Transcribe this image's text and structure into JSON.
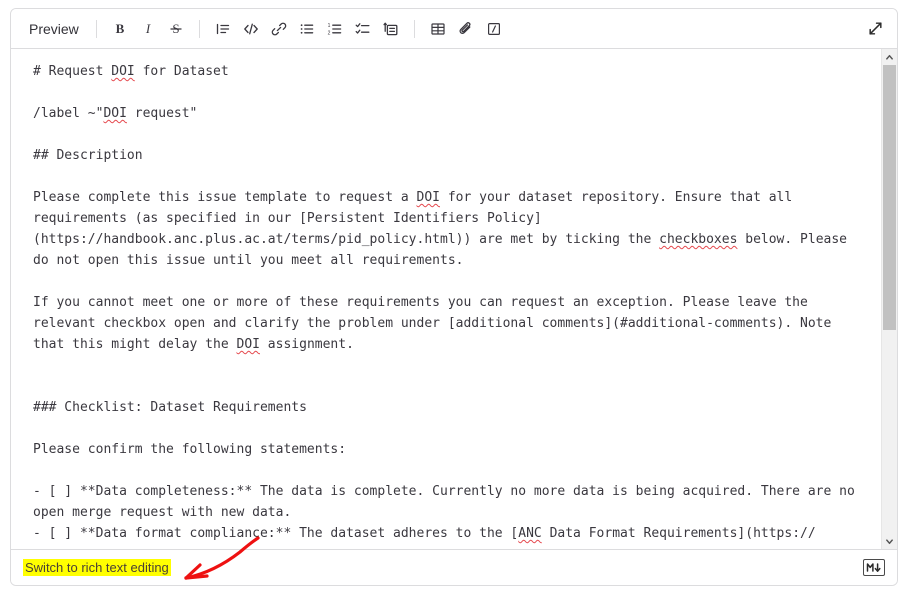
{
  "toolbar": {
    "preview_label": "Preview",
    "buttons": [
      {
        "name": "bold-button",
        "icon": "bold-icon",
        "title": "Bold"
      },
      {
        "name": "italic-button",
        "icon": "italic-icon",
        "title": "Italic"
      },
      {
        "name": "strikethrough-button",
        "icon": "strikethrough-icon",
        "title": "Strikethrough"
      },
      {
        "name": "blockquote-button",
        "icon": "blockquote-icon",
        "title": "Insert a quote"
      },
      {
        "name": "code-button",
        "icon": "code-icon",
        "title": "Insert code"
      },
      {
        "name": "link-button",
        "icon": "link-icon",
        "title": "Insert a link"
      },
      {
        "name": "bullet-list-button",
        "icon": "bullet-list-icon",
        "title": "Add a bullet list"
      },
      {
        "name": "numbered-list-button",
        "icon": "numbered-list-icon",
        "title": "Add a numbered list"
      },
      {
        "name": "checklist-button",
        "icon": "checklist-icon",
        "title": "Add a checklist"
      },
      {
        "name": "collapsible-section-button",
        "icon": "collapsible-section-icon",
        "title": "Add a collapsible section"
      },
      {
        "name": "table-button",
        "icon": "table-icon",
        "title": "Add a table"
      },
      {
        "name": "attach-file-button",
        "icon": "paperclip-icon",
        "title": "Attach a file or image"
      },
      {
        "name": "quick-actions-button",
        "icon": "slash-command-icon",
        "title": "Quick actions"
      }
    ],
    "expand_icon": "expand-diagonal-icon"
  },
  "editor": {
    "lines": [
      {
        "segments": [
          {
            "t": "# Request "
          },
          {
            "t": "DOI",
            "spell": true
          },
          {
            "t": " for Dataset"
          }
        ]
      },
      {
        "segments": [
          {
            "t": ""
          }
        ]
      },
      {
        "segments": [
          {
            "t": "/label ~\""
          },
          {
            "t": "DOI",
            "spell": true
          },
          {
            "t": " request\""
          }
        ]
      },
      {
        "segments": [
          {
            "t": ""
          }
        ]
      },
      {
        "segments": [
          {
            "t": "## Description"
          }
        ]
      },
      {
        "segments": [
          {
            "t": ""
          }
        ]
      },
      {
        "segments": [
          {
            "t": "Please complete this issue template to request a "
          },
          {
            "t": "DOI",
            "spell": true
          },
          {
            "t": " for your dataset repository. Ensure that all requirements (as specified in our [Persistent Identifiers Policy](https://handbook.anc.plus.ac.at/terms/pid_policy.html)) are met by ticking the "
          },
          {
            "t": "checkboxes",
            "spell": true
          },
          {
            "t": " below. Please do not open this issue until you meet all requirements."
          }
        ]
      },
      {
        "segments": [
          {
            "t": ""
          }
        ]
      },
      {
        "segments": [
          {
            "t": "If you cannot meet one or more of these requirements you can request an exception. Please leave the relevant checkbox open and clarify the problem under [additional comments](#additional-comments). Note that this might delay the "
          },
          {
            "t": "DOI",
            "spell": true
          },
          {
            "t": " assignment."
          }
        ]
      },
      {
        "segments": [
          {
            "t": ""
          }
        ]
      },
      {
        "segments": [
          {
            "t": ""
          }
        ]
      },
      {
        "segments": [
          {
            "t": "### Checklist: Dataset Requirements"
          }
        ]
      },
      {
        "segments": [
          {
            "t": ""
          }
        ]
      },
      {
        "segments": [
          {
            "t": "Please confirm the following statements:"
          }
        ]
      },
      {
        "segments": [
          {
            "t": ""
          }
        ]
      },
      {
        "segments": [
          {
            "t": "- [ ] **Data completeness:** The data is complete. Currently no more data is being acquired. There are no open merge request with new data."
          }
        ]
      },
      {
        "segments": [
          {
            "t": "- [ ] **Data format compliance:** The dataset adheres to the ["
          },
          {
            "t": "ANC",
            "spell": true
          },
          {
            "t": " Data Format Requirements](https://"
          }
        ]
      }
    ]
  },
  "footer": {
    "switch_label": "Switch to rich text editing",
    "markdown_badge_icon": "markdown-icon"
  },
  "scrollbar": {
    "up_icon": "chevron-up-icon",
    "down_icon": "chevron-down-icon"
  },
  "annotation": {
    "arrow_color": "#ee1111",
    "highlight_color": "#ffff00"
  }
}
